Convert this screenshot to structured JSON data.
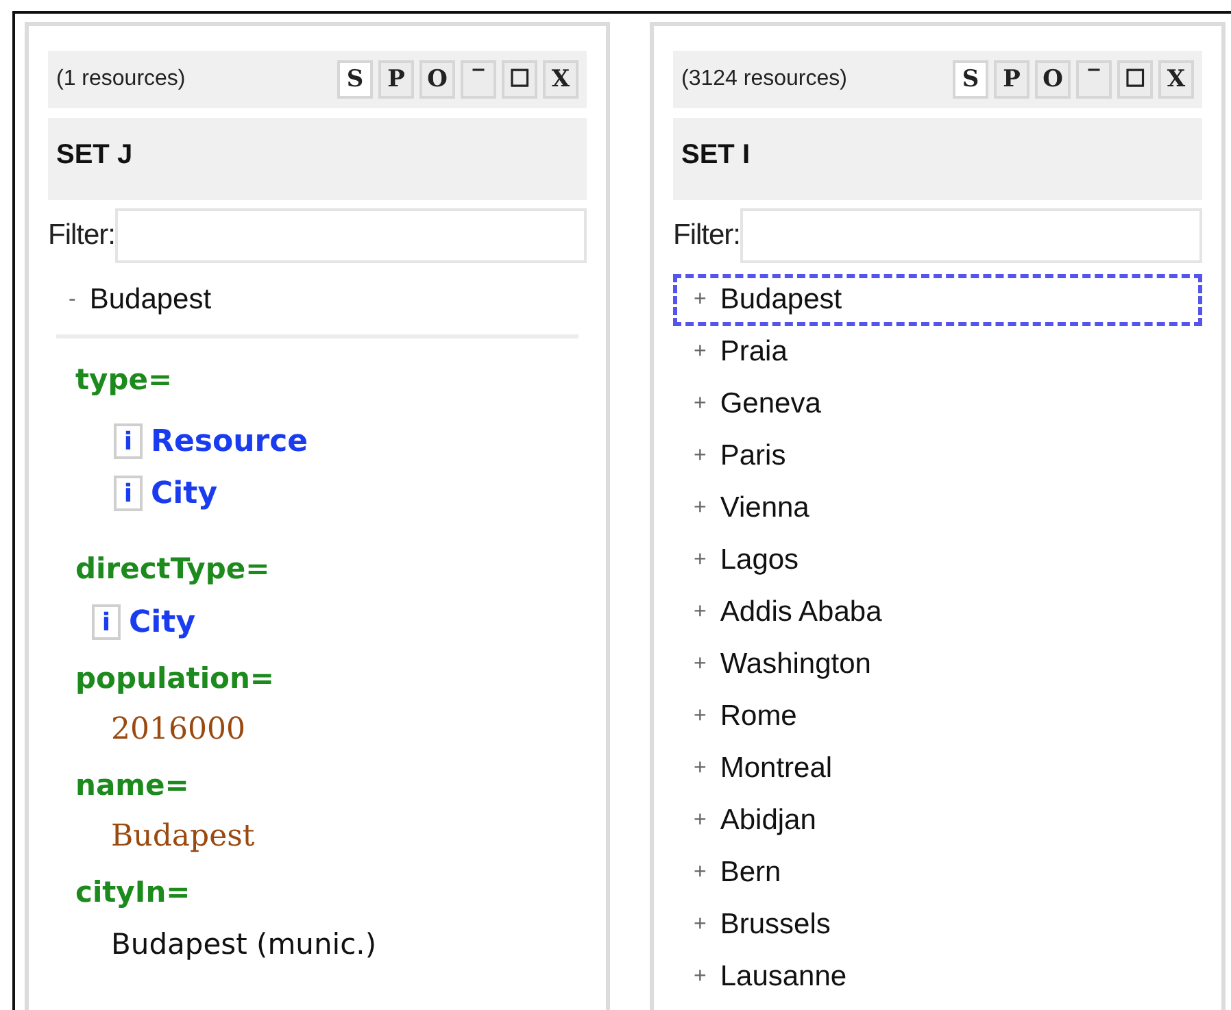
{
  "panels": [
    {
      "count": "(1 resources)",
      "buttons": [
        {
          "label": "S",
          "selected": true
        },
        {
          "label": "P",
          "selected": false
        },
        {
          "label": "O",
          "selected": false
        },
        {
          "label": "‾",
          "selected": false
        },
        {
          "label": "☐",
          "selected": false
        },
        {
          "label": "X",
          "selected": false
        }
      ],
      "title": "SET J",
      "filter_label": "Filter:",
      "items": [
        {
          "toggle": "-",
          "label": "Budapest",
          "focused": false
        }
      ],
      "properties": [
        {
          "name": "type=",
          "nested": true,
          "values": [
            {
              "kind": "link",
              "icon": "i",
              "text": "Resource"
            },
            {
              "kind": "link",
              "icon": "i",
              "text": "City"
            }
          ]
        },
        {
          "name": "directType=",
          "nested": false,
          "values": [
            {
              "kind": "link",
              "icon": "i",
              "text": "City"
            }
          ]
        },
        {
          "name": "population=",
          "nested": false,
          "values": [
            {
              "kind": "literal",
              "text": "2016000"
            }
          ]
        },
        {
          "name": "name=",
          "nested": false,
          "values": [
            {
              "kind": "literal",
              "text": "Budapest"
            }
          ]
        },
        {
          "name": "cityIn=",
          "nested": false,
          "values": [
            {
              "kind": "plain",
              "text": "Budapest (munic.)"
            }
          ]
        }
      ]
    },
    {
      "count": "(3124 resources)",
      "buttons": [
        {
          "label": "S",
          "selected": true
        },
        {
          "label": "P",
          "selected": false
        },
        {
          "label": "O",
          "selected": false
        },
        {
          "label": "‾",
          "selected": false
        },
        {
          "label": "☐",
          "selected": false
        },
        {
          "label": "X",
          "selected": false
        }
      ],
      "title": "SET I",
      "filter_label": "Filter:",
      "items": [
        {
          "toggle": "+",
          "label": "Budapest",
          "focused": true
        },
        {
          "toggle": "+",
          "label": "Praia",
          "focused": false
        },
        {
          "toggle": "+",
          "label": "Geneva",
          "focused": false
        },
        {
          "toggle": "+",
          "label": "Paris",
          "focused": false
        },
        {
          "toggle": "+",
          "label": "Vienna",
          "focused": false
        },
        {
          "toggle": "+",
          "label": "Lagos",
          "focused": false
        },
        {
          "toggle": "+",
          "label": "Addis Ababa",
          "focused": false
        },
        {
          "toggle": "+",
          "label": "Washington",
          "focused": false
        },
        {
          "toggle": "+",
          "label": "Rome",
          "focused": false
        },
        {
          "toggle": "+",
          "label": "Montreal",
          "focused": false
        },
        {
          "toggle": "+",
          "label": "Abidjan",
          "focused": false
        },
        {
          "toggle": "+",
          "label": "Bern",
          "focused": false
        },
        {
          "toggle": "+",
          "label": "Brussels",
          "focused": false
        },
        {
          "toggle": "+",
          "label": "Lausanne",
          "focused": false
        }
      ]
    }
  ]
}
